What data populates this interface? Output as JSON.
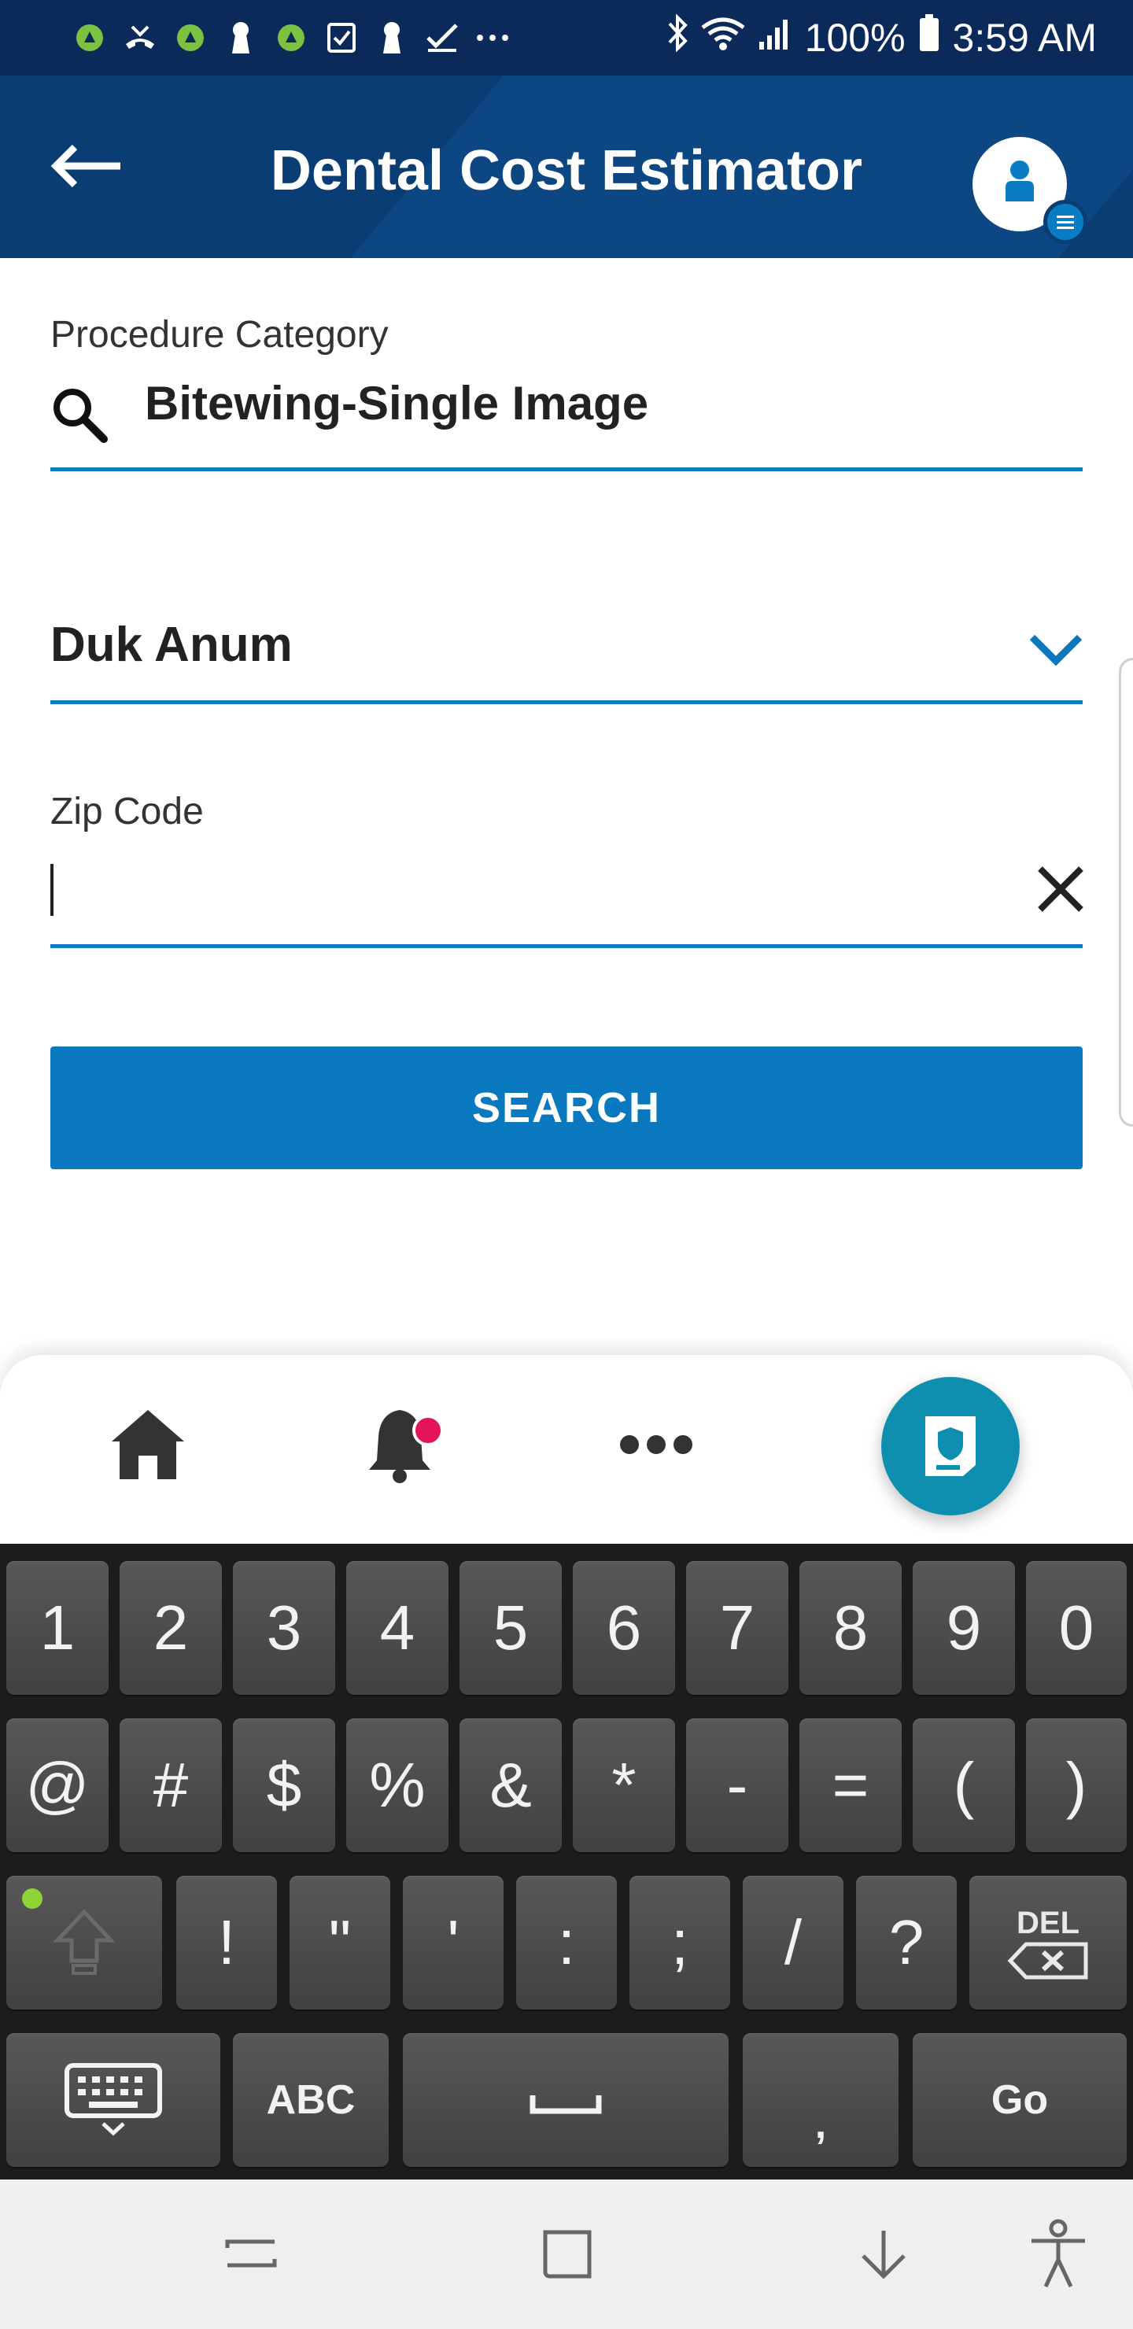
{
  "status_bar": {
    "battery": "100%",
    "time": "3:59 AM",
    "icons": [
      "app-icon",
      "missed-call-icon",
      "app-icon",
      "keyhole-icon",
      "app-icon",
      "checkbox-icon",
      "keyhole-icon",
      "check-icon",
      "more-dots-icon",
      "bluetooth-icon",
      "wifi-icon",
      "signal-icon",
      "battery-icon"
    ]
  },
  "app_bar": {
    "title": "Dental Cost Estimator",
    "back_icon": "back-arrow-icon",
    "profile_icon": "profile-icon"
  },
  "form": {
    "procedure_label": "Procedure Category",
    "procedure_value": "Bitewing-Single Image",
    "provider_value": "Duk Anum",
    "zip_label": "Zip Code",
    "zip_value": "",
    "search_button": "SEARCH"
  },
  "bottom_nav": {
    "items": [
      "home-icon",
      "bell-icon",
      "more-icon",
      "insurance-card-icon"
    ],
    "notification_color": "#e4135a"
  },
  "keyboard": {
    "row1": [
      "1",
      "2",
      "3",
      "4",
      "5",
      "6",
      "7",
      "8",
      "9",
      "0"
    ],
    "row2": [
      "@",
      "#",
      "$",
      "%",
      "&",
      "*",
      "-",
      "=",
      "(",
      ")"
    ],
    "row3": [
      "!",
      "\"",
      "'",
      ":",
      ";",
      "/",
      "?"
    ],
    "del_label": "DEL",
    "abc_label": "ABC",
    "comma_label": ",",
    "go_label": "Go"
  },
  "colors": {
    "status_bar": "#0b2a5a",
    "app_bar": "#0a3d74",
    "accent": "#0a78bf",
    "fab": "#0f8fb0"
  }
}
